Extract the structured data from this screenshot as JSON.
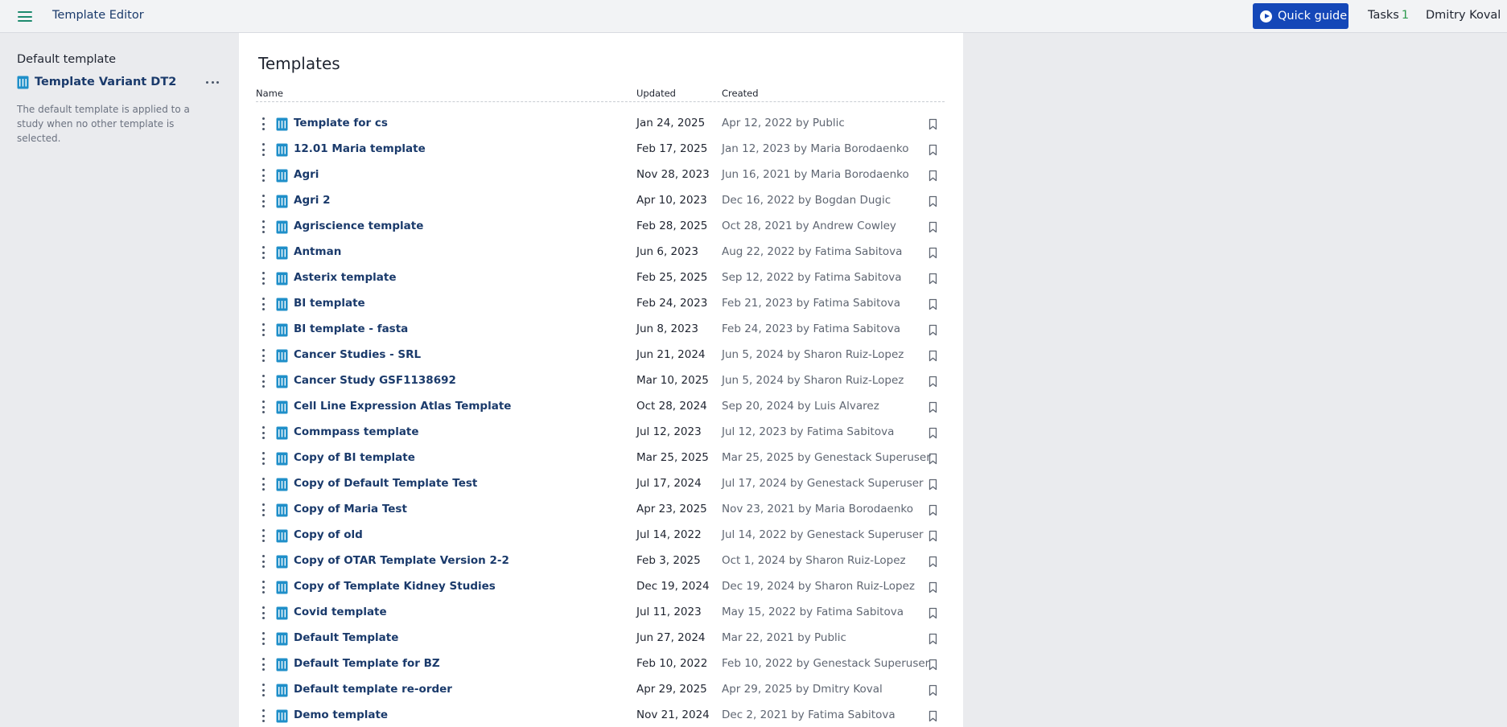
{
  "app": {
    "title": "Template Editor"
  },
  "header": {
    "quick_guide_label": "Quick guide",
    "tasks_label": "Tasks",
    "tasks_count": "1",
    "user_name": "Dmitry Koval"
  },
  "sidebar": {
    "heading": "Default template",
    "default_template": "Template Variant DT2",
    "description": "The default template is applied to a study when no other template is selected."
  },
  "main": {
    "title": "Templates",
    "columns": {
      "name": "Name",
      "updated": "Updated",
      "created": "Created"
    },
    "rows": [
      {
        "name": "Template for cs",
        "updated": "Jan 24, 2025",
        "created": "Apr 12, 2022 by Public"
      },
      {
        "name": "12.01 Maria template",
        "updated": "Feb 17, 2025",
        "created": "Jan 12, 2023 by Maria Borodaenko"
      },
      {
        "name": "Agri",
        "updated": "Nov 28, 2023",
        "created": "Jun 16, 2021 by Maria Borodaenko"
      },
      {
        "name": "Agri 2",
        "updated": "Apr 10, 2023",
        "created": "Dec 16, 2022 by Bogdan Dugic"
      },
      {
        "name": "Agriscience template",
        "updated": "Feb 28, 2025",
        "created": "Oct 28, 2021 by Andrew Cowley"
      },
      {
        "name": "Antman",
        "updated": "Jun 6, 2023",
        "created": "Aug 22, 2022 by Fatima Sabitova"
      },
      {
        "name": "Asterix template",
        "updated": "Feb 25, 2025",
        "created": "Sep 12, 2022 by Fatima Sabitova"
      },
      {
        "name": "BI template",
        "updated": "Feb 24, 2023",
        "created": "Feb 21, 2023 by Fatima Sabitova"
      },
      {
        "name": "BI template - fasta",
        "updated": "Jun 8, 2023",
        "created": "Feb 24, 2023 by Fatima Sabitova"
      },
      {
        "name": "Cancer Studies - SRL",
        "updated": "Jun 21, 2024",
        "created": "Jun 5, 2024 by Sharon Ruiz-Lopez"
      },
      {
        "name": "Cancer Study GSF1138692",
        "updated": "Mar 10, 2025",
        "created": "Jun 5, 2024 by Sharon Ruiz-Lopez"
      },
      {
        "name": "Cell Line Expression Atlas Template",
        "updated": "Oct 28, 2024",
        "created": "Sep 20, 2024 by Luis Alvarez"
      },
      {
        "name": "Commpass template",
        "updated": "Jul 12, 2023",
        "created": "Jul 12, 2023 by Fatima Sabitova"
      },
      {
        "name": "Copy of BI template",
        "updated": "Mar 25, 2025",
        "created": "Mar 25, 2025 by Genestack Superuser"
      },
      {
        "name": "Copy of Default Template Test",
        "updated": "Jul 17, 2024",
        "created": "Jul 17, 2024 by Genestack Superuser"
      },
      {
        "name": "Copy of Maria Test",
        "updated": "Apr 23, 2025",
        "created": "Nov 23, 2021 by Maria Borodaenko"
      },
      {
        "name": "Copy of old",
        "updated": "Jul 14, 2022",
        "created": "Jul 14, 2022 by Genestack Superuser"
      },
      {
        "name": "Copy of OTAR Template Version 2-2",
        "updated": "Feb 3, 2025",
        "created": "Oct 1, 2024 by Sharon Ruiz-Lopez"
      },
      {
        "name": "Copy of Template Kidney Studies",
        "updated": "Dec 19, 2024",
        "created": "Dec 19, 2024 by Sharon Ruiz-Lopez"
      },
      {
        "name": "Covid template",
        "updated": "Jul 11, 2023",
        "created": "May 15, 2022 by Fatima Sabitova"
      },
      {
        "name": "Default Template",
        "updated": "Jun 27, 2024",
        "created": "Mar 22, 2021 by Public"
      },
      {
        "name": "Default Template for BZ",
        "updated": "Feb 10, 2022",
        "created": "Feb 10, 2022 by Genestack Superuser"
      },
      {
        "name": "Default template re-order",
        "updated": "Apr 29, 2025",
        "created": "Apr 29, 2025 by Dmitry Koval"
      },
      {
        "name": "Demo template",
        "updated": "Nov 21, 2024",
        "created": "Dec 2, 2021 by Fatima Sabitova"
      }
    ]
  },
  "icons": {
    "menu": "hamburger-menu-icon",
    "quick_guide": "play-circle-icon",
    "template": "template-document-icon",
    "more": "more-horizontal-icon",
    "row_actions": "more-vertical-icon",
    "bookmark": "bookmark-icon"
  },
  "colors": {
    "accent_button": "#1447b8",
    "link": "#1a3a6b",
    "template_icon": "#1f8fc9",
    "menu_icon": "#1e8a6e",
    "tasks_count": "#2e9a4f"
  }
}
